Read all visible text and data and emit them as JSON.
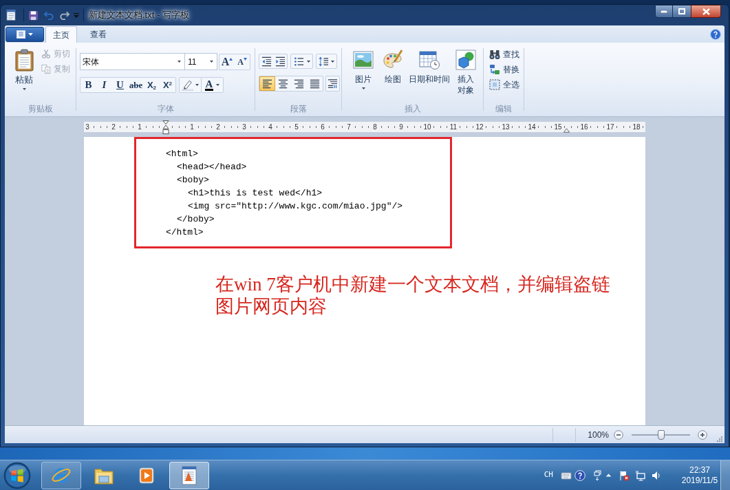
{
  "window": {
    "title": "新建文本文档.txt - 写字板"
  },
  "quick_access": [
    {
      "kind": "save",
      "disabled": false
    },
    {
      "kind": "undo",
      "disabled": false
    },
    {
      "kind": "redo",
      "disabled": true
    }
  ],
  "ribbon": {
    "tabs": [
      {
        "label": "主页",
        "selected": true
      },
      {
        "label": "查看",
        "selected": false
      }
    ],
    "clipboard": {
      "label": "剪贴板",
      "paste": {
        "label": "粘贴"
      },
      "items": [
        {
          "kind": "cut",
          "label": "剪切",
          "disabled": true
        },
        {
          "kind": "copy",
          "label": "复制",
          "disabled": true
        }
      ]
    },
    "font": {
      "label": "字体",
      "family": "宋体",
      "size": "11",
      "size_buttons": [
        {
          "kind": "grow",
          "label": "A"
        },
        {
          "kind": "shrink",
          "label": "A"
        }
      ],
      "format_buttons": [
        {
          "kind": "bold",
          "label": "B"
        },
        {
          "kind": "italic",
          "label": "I"
        },
        {
          "kind": "underline",
          "label": "U"
        },
        {
          "kind": "strike",
          "label": "abe"
        },
        {
          "kind": "subscript",
          "label": "X$_{2}$"
        },
        {
          "kind": "superscript",
          "label": "X$^{2}$"
        }
      ],
      "color_button": {
        "label": "A"
      }
    },
    "paragraph": {
      "label": "段落",
      "alignments": [
        {
          "kind": "left",
          "selected": true
        },
        {
          "kind": "center",
          "selected": false
        },
        {
          "kind": "right",
          "selected": false
        },
        {
          "kind": "justify",
          "selected": false
        }
      ]
    },
    "insert": {
      "label": "插入",
      "items": [
        {
          "kind": "picture",
          "label": "图片",
          "dropdown": true
        },
        {
          "kind": "paint",
          "label": "绘图",
          "dropdown": false
        },
        {
          "kind": "datetime",
          "label": "日期和时间",
          "dropdown": false
        },
        {
          "kind": "object",
          "label": "插入对象",
          "dropdown": false
        }
      ]
    },
    "editing": {
      "label": "编辑",
      "items": [
        {
          "kind": "find",
          "label": "查找"
        },
        {
          "kind": "replace",
          "label": "替换"
        },
        {
          "kind": "select_all",
          "label": "全选"
        }
      ]
    }
  },
  "ruler": {
    "labels": [
      "3",
      "2",
      "1",
      "1",
      "2",
      "3",
      "4",
      "5",
      "6",
      "7",
      "8",
      "9",
      "10",
      "11",
      "12",
      "13",
      "14",
      "15",
      "16",
      "17",
      "18"
    ]
  },
  "document": {
    "lines": [
      {
        "text": "<html>",
        "children": [
          {
            "text": "<head></head>"
          },
          {
            "text": "<boby>",
            "children": [
              {
                "text": "<h1>this is test wed</h1>"
              },
              {
                "text": "<img src=\"http://www.kgc.com/miao.jpg\"/>"
              }
            ]
          },
          {
            "text": "</boby>"
          }
        ]
      },
      {
        "text": "</html>"
      }
    ]
  },
  "annotation": {
    "text": "在win 7客户机中新建一个文本文档，并编辑盗链图片网页内容"
  },
  "status_bar": {
    "zoom": {
      "reading": "100%",
      "level": 0.5
    }
  },
  "taskbar": {
    "apps": [
      {
        "kind": "browser",
        "running": true,
        "selected": false
      },
      {
        "kind": "folder",
        "running": false,
        "selected": false
      },
      {
        "kind": "media",
        "running": false,
        "selected": false
      },
      {
        "kind": "wordpad",
        "running": true,
        "selected": true
      }
    ],
    "tray": {
      "language": "CH",
      "time": "22:37",
      "date": "2019/11/5"
    }
  }
}
